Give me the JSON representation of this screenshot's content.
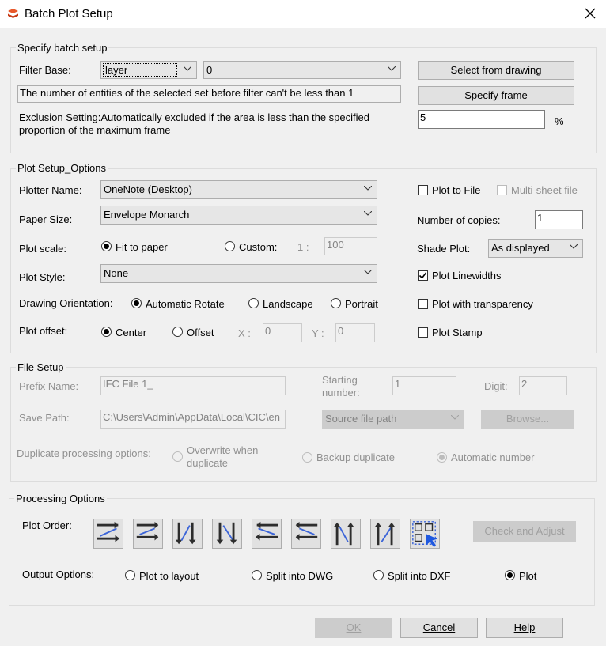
{
  "window": {
    "title": "Batch Plot Setup"
  },
  "batch": {
    "legend": "Specify batch setup",
    "filter_label": "Filter Base:",
    "filter_value": "layer",
    "filter_second": "0",
    "info_text": "The number of entities of the selected set before filter can't be less than 1",
    "select_btn": "Select from drawing",
    "frame_btn": "Specify frame",
    "exclusion_line1": "Exclusion Setting:Automatically excluded if the area is less than the specified",
    "exclusion_line2": "proportion of the maximum frame",
    "exclusion_value": "5",
    "percent": "%"
  },
  "plot": {
    "legend": "Plot Setup_Options",
    "plotter_label": "Plotter Name:",
    "plotter_value": "OneNote (Desktop)",
    "paper_label": "Paper Size:",
    "paper_value": "Envelope Monarch",
    "scale_label": "Plot scale:",
    "fit_label": "Fit to paper",
    "custom_label": "Custom:",
    "ratio": "1 :",
    "custom_value": "100",
    "style_label": "Plot Style:",
    "style_value": "None",
    "orient_label": "Drawing Orientation:",
    "auto_rotate": "Automatic Rotate",
    "landscape": "Landscape",
    "portrait": "Portrait",
    "offset_label": "Plot offset:",
    "center": "Center",
    "offset": "Offset",
    "x_label": "X :",
    "x_value": "0",
    "y_label": "Y :",
    "y_value": "0",
    "plot_to_file": "Plot to File",
    "multi_sheet": "Multi-sheet file",
    "copies_label": "Number of copies:",
    "copies_value": "1",
    "shade_label": "Shade Plot:",
    "shade_value": "As displayed",
    "linewidths": "Plot Linewidths",
    "transparency": "Plot with transparency",
    "stamp": "Plot Stamp"
  },
  "file": {
    "legend": "File Setup",
    "prefix_label": "Prefix Name:",
    "prefix_value": "IFC File 1_",
    "starting_line1": "Starting",
    "starting_line2": "number:",
    "starting_value": "1",
    "digit_label": "Digit:",
    "digit_value": "2",
    "save_label": "Save Path:",
    "save_value": "C:\\Users\\Admin\\AppData\\Local\\CIC\\en",
    "source_value": "Source file path",
    "browse_btn": "Browse...",
    "dup_label": "Duplicate processing options:",
    "overwrite_line1": "Overwrite when",
    "overwrite_line2": "duplicate",
    "backup": "Backup duplicate",
    "auto_number": "Automatic number"
  },
  "processing": {
    "legend": "Processing Options",
    "order_label": "Plot Order:",
    "check_btn": "Check and Adjust",
    "output_label": "Output Options:",
    "to_layout": "Plot to layout",
    "split_dwg": "Split into DWG",
    "split_dxf": "Split into DXF",
    "plot": "Plot"
  },
  "footer": {
    "ok": "OK",
    "cancel": "Cancel",
    "help": "Help"
  }
}
